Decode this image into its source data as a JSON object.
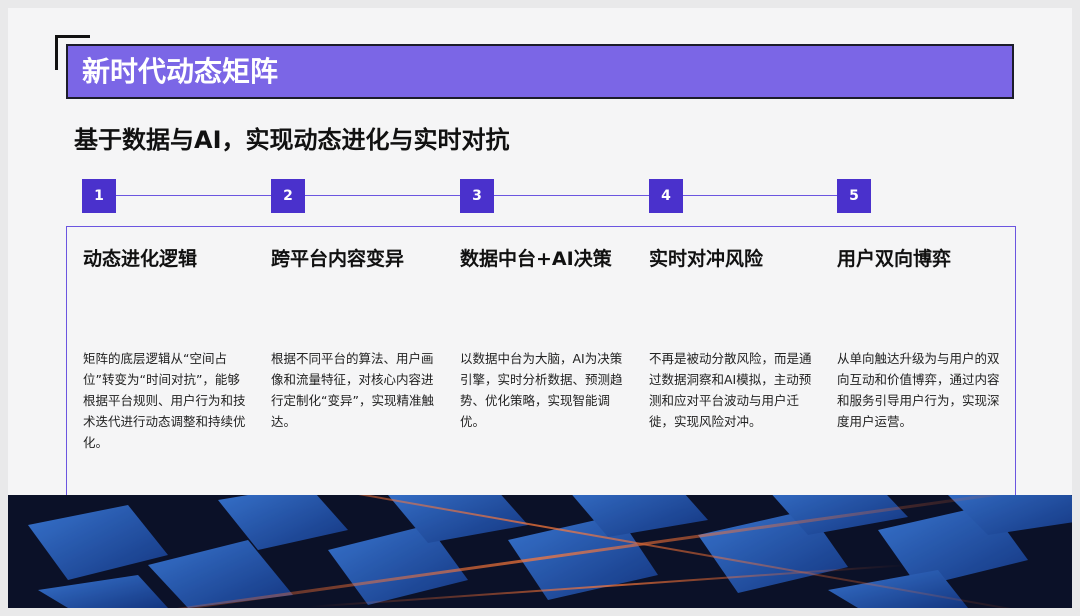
{
  "title": "新时代动态矩阵",
  "subtitle": "基于数据与AI，实现动态进化与实时对抗",
  "steps": [
    {
      "num": "1",
      "title": "动态进化逻辑",
      "desc": "矩阵的底层逻辑从“空间占位”转变为“时间对抗”，能够根据平台规则、用户行为和技术迭代进行动态调整和持续优化。"
    },
    {
      "num": "2",
      "title": "跨平台内容变异",
      "desc": "根据不同平台的算法、用户画像和流量特征，对核心内容进行定制化“变异”，实现精准触达。"
    },
    {
      "num": "3",
      "title": "数据中台+AI决策",
      "desc": "以数据中台为大脑，AI为决策引擎，实时分析数据、预测趋势、优化策略，实现智能调优。"
    },
    {
      "num": "4",
      "title": "实时对冲风险",
      "desc": "不再是被动分散风险，而是通过数据洞察和AI模拟，主动预测和应对平台波动与用户迁徙，实现风险对冲。"
    },
    {
      "num": "5",
      "title": "用户双向博弈",
      "desc": "从单向触达升级为与用户的双向互动和价值博弈，通过内容和服务引导用户行为，实现深度用户运营。"
    }
  ],
  "colors": {
    "accent": "#7b66e6",
    "step": "#4a31cc",
    "line": "#6b55e0"
  }
}
